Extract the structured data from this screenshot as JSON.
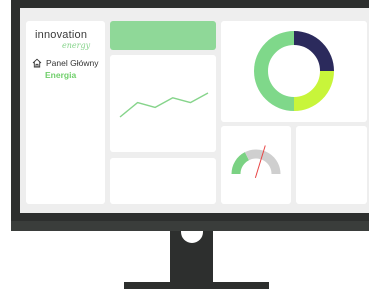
{
  "sidebar": {
    "logo": {
      "main": "innovation",
      "sub": "energy"
    },
    "nav": {
      "item_label": "Panel Główny",
      "icon": "home-icon",
      "sub_label": "Energia"
    }
  },
  "colors": {
    "accent_green": "#86d48b",
    "donut_green": "#7fd88a",
    "donut_navy": "#2b2a5c",
    "donut_lime": "#c8f53a",
    "gauge_green": "#7bd283",
    "gauge_gray": "#cfcfcf",
    "needle_red": "#e84444"
  },
  "line_chart": {
    "values": [
      3,
      6,
      5,
      7,
      6,
      8
    ]
  },
  "donut": {
    "segments": [
      {
        "value": 25
      },
      {
        "value": 25
      },
      {
        "value": 50
      }
    ]
  },
  "gauge": {
    "value": 0.6
  }
}
